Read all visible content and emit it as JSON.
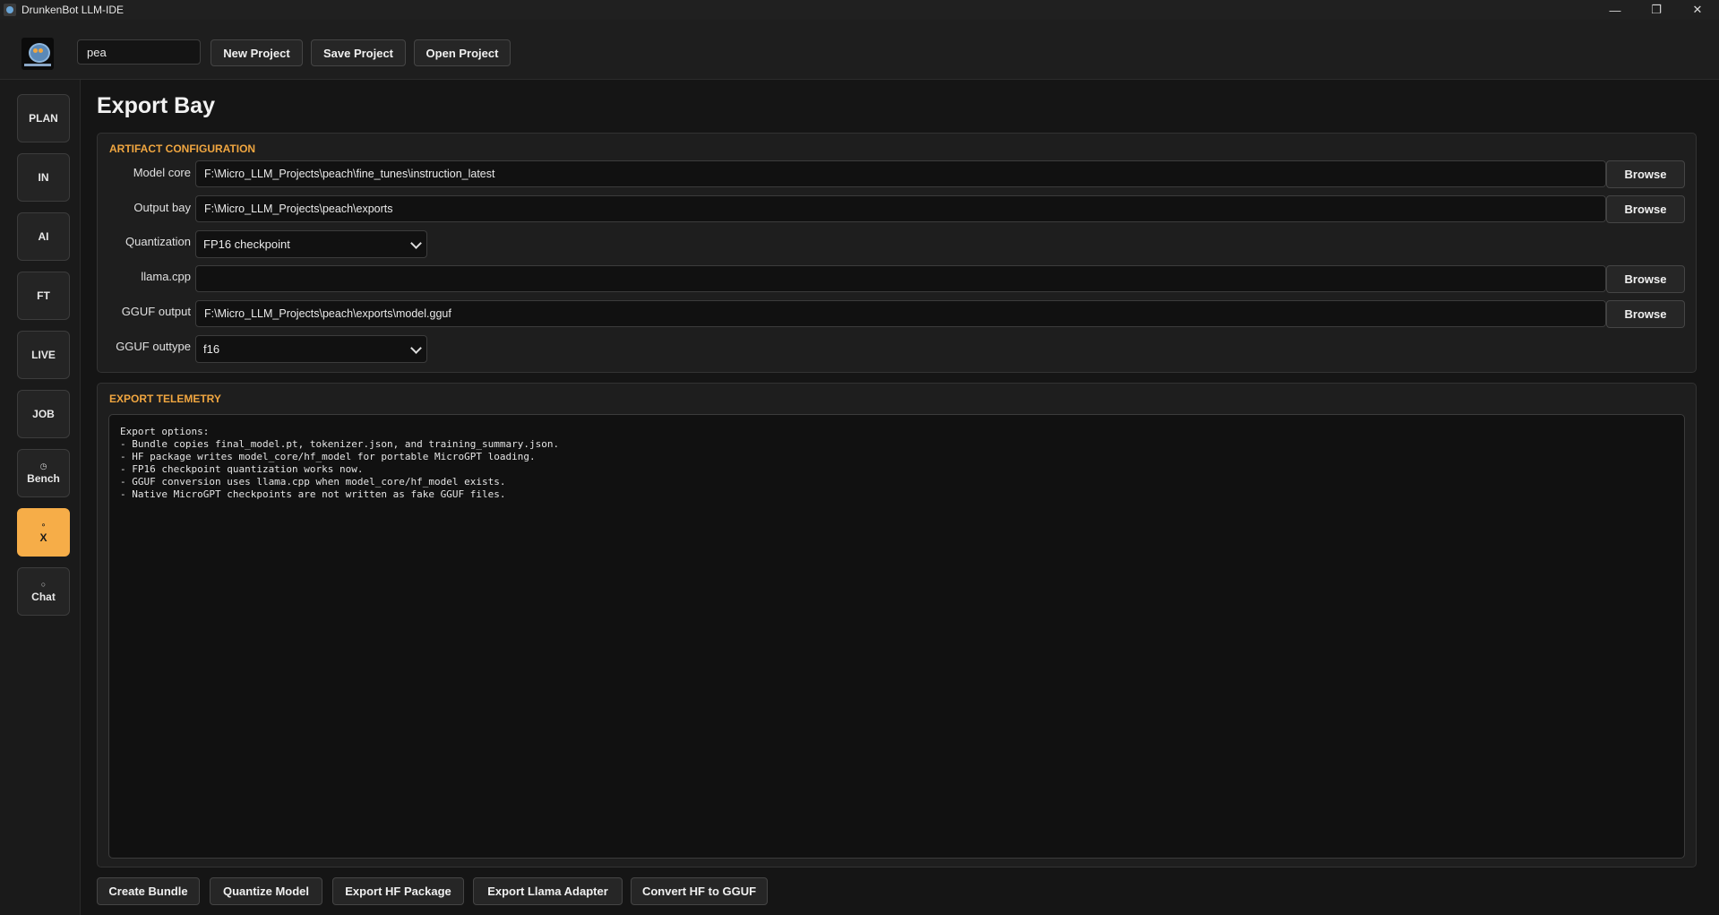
{
  "window": {
    "title": "DrunkenBot LLM-IDE",
    "controls": {
      "minimize": "—",
      "maximize": "❐",
      "close": "✕"
    }
  },
  "toolbar": {
    "project_name": "pea",
    "new_project": "New Project",
    "save_project": "Save Project",
    "open_project": "Open Project"
  },
  "sidebar": {
    "items": [
      {
        "label": "PLAN",
        "icon": ""
      },
      {
        "label": "IN",
        "icon": ""
      },
      {
        "label": "AI",
        "icon": ""
      },
      {
        "label": "FT",
        "icon": ""
      },
      {
        "label": "LIVE",
        "icon": ""
      },
      {
        "label": "JOB",
        "icon": ""
      },
      {
        "label": "Bench",
        "icon": "◷"
      },
      {
        "label": "X",
        "icon": "⚬"
      },
      {
        "label": "Chat",
        "icon": "○"
      }
    ],
    "active": "X",
    "active_color": "#f6ad48"
  },
  "page": {
    "title": "Export Bay"
  },
  "artifact": {
    "section_title": "ARTIFACT CONFIGURATION",
    "model_core": {
      "label": "Model core",
      "value": "F:\\Micro_LLM_Projects\\peach\\fine_tunes\\instruction_latest",
      "browse": "Browse"
    },
    "output_bay": {
      "label": "Output bay",
      "value": "F:\\Micro_LLM_Projects\\peach\\exports",
      "browse": "Browse"
    },
    "quantization": {
      "label": "Quantization",
      "value": "FP16 checkpoint"
    },
    "llama_cpp": {
      "label": "llama.cpp",
      "value": "",
      "browse": "Browse"
    },
    "gguf_output": {
      "label": "GGUF output",
      "value": "F:\\Micro_LLM_Projects\\peach\\exports\\model.gguf",
      "browse": "Browse"
    },
    "gguf_outtype": {
      "label": "GGUF outtype",
      "value": "f16"
    }
  },
  "telemetry": {
    "section_title": "EXPORT TELEMETRY",
    "log": "Export options:\n- Bundle copies final_model.pt, tokenizer.json, and training_summary.json.\n- HF package writes model_core/hf_model for portable MicroGPT loading.\n- FP16 checkpoint quantization works now.\n- GGUF conversion uses llama.cpp when model_core/hf_model exists.\n- Native MicroGPT checkpoints are not written as fake GGUF files."
  },
  "actions": {
    "create_bundle": "Create Bundle",
    "quantize_model": "Quantize Model",
    "export_hf_package": "Export HF Package",
    "export_llama_adapter": "Export Llama Adapter",
    "convert_hf_to_gguf": "Convert HF to GGUF"
  },
  "colors": {
    "accent": "#f0a640",
    "background": "#151515",
    "panel": "#1e1e1e"
  }
}
